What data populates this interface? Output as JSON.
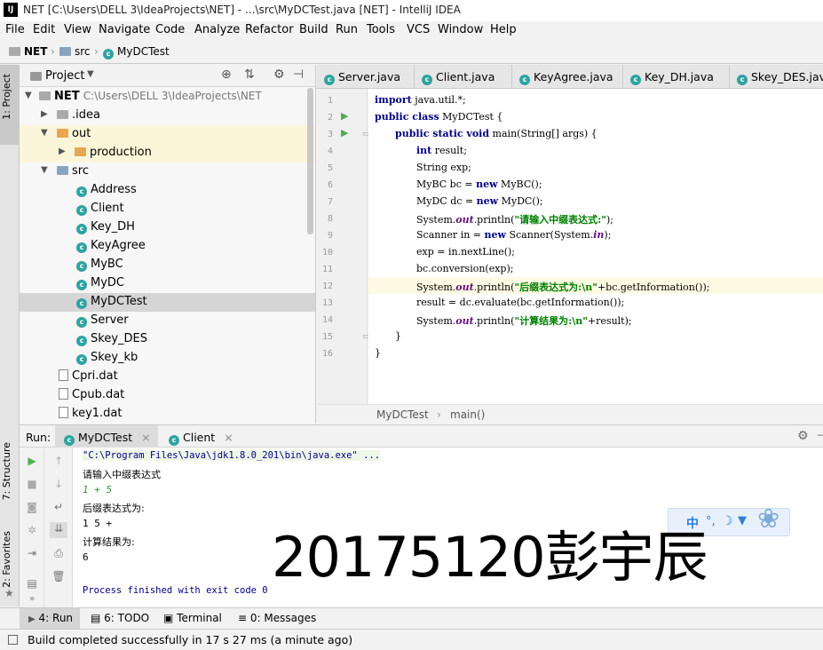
{
  "window": {
    "logo": "IJ",
    "title": "NET [C:\\Users\\DELL 3\\IdeaProjects\\NET] - ...\\src\\MyDCTest.java [NET] - IntelliJ IDEA"
  },
  "menu": [
    "File",
    "Edit",
    "View",
    "Navigate",
    "Code",
    "Analyze",
    "Refactor",
    "Build",
    "Run",
    "Tools",
    "VCS",
    "Window",
    "Help"
  ],
  "breadcrumb": {
    "project": "NET",
    "folder": "src",
    "file": "MyDCTest"
  },
  "left_strip": {
    "project_tab": "1: Project",
    "structure_tab": "7: Structure",
    "favorites_tab": "2: Favorites"
  },
  "project_panel": {
    "title": "Project",
    "tree": [
      {
        "label": "NET",
        "path": "C:\\Users\\DELL 3\\IdeaProjects\\NET",
        "kind": "folder-gray"
      },
      {
        "label": ".idea",
        "kind": "folder-gray"
      },
      {
        "label": "out",
        "kind": "folder-orange"
      },
      {
        "label": "production",
        "kind": "folder-orange"
      },
      {
        "label": "src",
        "kind": "folder-blue"
      },
      {
        "label": "Address",
        "kind": "class"
      },
      {
        "label": "Client",
        "kind": "class"
      },
      {
        "label": "Key_DH",
        "kind": "class"
      },
      {
        "label": "KeyAgree",
        "kind": "class"
      },
      {
        "label": "MyBC",
        "kind": "class"
      },
      {
        "label": "MyDC",
        "kind": "class"
      },
      {
        "label": "MyDCTest",
        "kind": "class"
      },
      {
        "label": "Server",
        "kind": "class"
      },
      {
        "label": "Skey_DES",
        "kind": "class"
      },
      {
        "label": "Skey_kb",
        "kind": "class"
      },
      {
        "label": "Cpri.dat",
        "kind": "file"
      },
      {
        "label": "Cpub.dat",
        "kind": "file"
      },
      {
        "label": "key1.dat",
        "kind": "file"
      }
    ]
  },
  "editor": {
    "tabs": [
      "Server.java",
      "Client.java",
      "KeyAgree.java",
      "Key_DH.java",
      "Skey_DES.java"
    ],
    "line_numbers": [
      "1",
      "2",
      "3",
      "4",
      "5",
      "6",
      "7",
      "8",
      "9",
      "10",
      "11",
      "12",
      "13",
      "14",
      "15",
      "16"
    ],
    "code": {
      "l1a": "import",
      "l1b": " java.util.*;",
      "l2a": "public class",
      "l2b": " MyDCTest {",
      "l3a": "public static void",
      "l3b": " main(String[] args) {",
      "l4a": "int",
      "l4b": " result;",
      "l5": "String exp;",
      "l6a": "MyBC bc = ",
      "l6b": "new",
      "l6c": " MyBC();",
      "l7a": "MyDC dc = ",
      "l7b": "new",
      "l7c": " MyDC();",
      "l8a": "System.",
      "l8b": "out",
      "l8c": ".println(",
      "l8d": "\"请输入中缀表达式:\"",
      "l8e": ");",
      "l9a": "Scanner in = ",
      "l9b": "new",
      "l9c": " Scanner(System.",
      "l9d": "in",
      "l9e": ");",
      "l10": "exp = in.nextLine();",
      "l11": "bc.conversion(exp);",
      "l12a": "System.",
      "l12b": "out",
      "l12c": ".println(",
      "l12d": "\"后缀表达式为:\\n\"",
      "l12e": "+bc.getInformation());",
      "l13": "result = dc.evaluate(bc.getInformation());",
      "l14a": "System.",
      "l14b": "out",
      "l14c": ".println(",
      "l14d": "\"计算结果为:\\n\"",
      "l14e": "+result);",
      "l15": "}",
      "l16": "}"
    },
    "status_crumbs": {
      "cls": "MyDCTest",
      "method": "main()"
    }
  },
  "run_panel": {
    "label": "Run:",
    "tabs": [
      "MyDCTest",
      "Client"
    ],
    "console": {
      "cmd": "\"C:\\Program Files\\Java\\jdk1.8.0_201\\bin\\java.exe\" ...",
      "prompt1": "请输入中缀表达式",
      "input": "1 + 5",
      "prompt2": "后缀表达式为:",
      "postfix": "1 5 +",
      "prompt3": "计算结果为:",
      "result": "6",
      "exit": "Process finished with exit code 0"
    }
  },
  "bottom_tabs": [
    {
      "label": "4: Run"
    },
    {
      "label": "6: TODO"
    },
    {
      "label": "Terminal"
    },
    {
      "label": "0: Messages"
    }
  ],
  "status": "Build completed successfully in 17 s 27 ms (a minute ago)",
  "watermark": "20175120彭宇辰",
  "ime": {
    "lang": "中"
  },
  "colors": {
    "keyword": "#000080",
    "string": "#008000",
    "field": "#660e7a",
    "run_green": "#4caf50",
    "selected_row": "#d5d5d5",
    "line_highlight": "#fffae3"
  }
}
